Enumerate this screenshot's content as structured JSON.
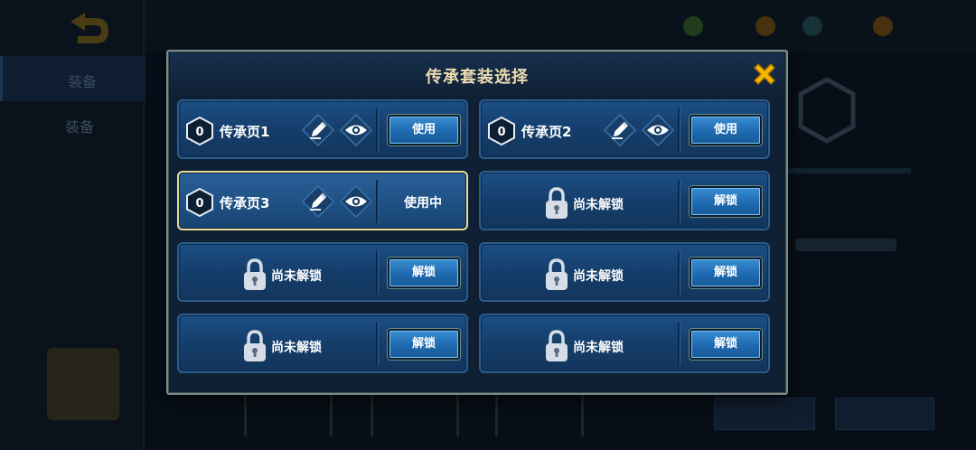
{
  "background": {
    "sidebar_tabs": [
      "装备",
      "装备"
    ],
    "coins": [
      "",
      "",
      ""
    ]
  },
  "modal": {
    "title": "传承套装选择",
    "slots": [
      {
        "state": "available",
        "number": "0",
        "name": "传承页1",
        "button": "使用"
      },
      {
        "state": "available",
        "number": "0",
        "name": "传承页2",
        "button": "使用"
      },
      {
        "state": "active",
        "number": "0",
        "name": "传承页3",
        "status": "使用中"
      },
      {
        "state": "locked",
        "label": "尚未解锁",
        "button": "解锁"
      },
      {
        "state": "locked",
        "label": "尚未解锁",
        "button": "解锁"
      },
      {
        "state": "locked",
        "label": "尚未解锁",
        "button": "解锁"
      },
      {
        "state": "locked",
        "label": "尚未解锁",
        "button": "解锁"
      },
      {
        "state": "locked",
        "label": "尚未解锁",
        "button": "解锁"
      }
    ]
  },
  "colors": {
    "title": "#ecdcb0",
    "close_icon": "#f5b800",
    "active_border": "#e8dc98",
    "card": "#163f6d",
    "button": "#1f69b0"
  },
  "icons": {
    "close": "close-icon",
    "edit": "pencil-icon",
    "view": "eye-icon",
    "lock": "lock-icon",
    "number": "hexagon-number-icon"
  }
}
